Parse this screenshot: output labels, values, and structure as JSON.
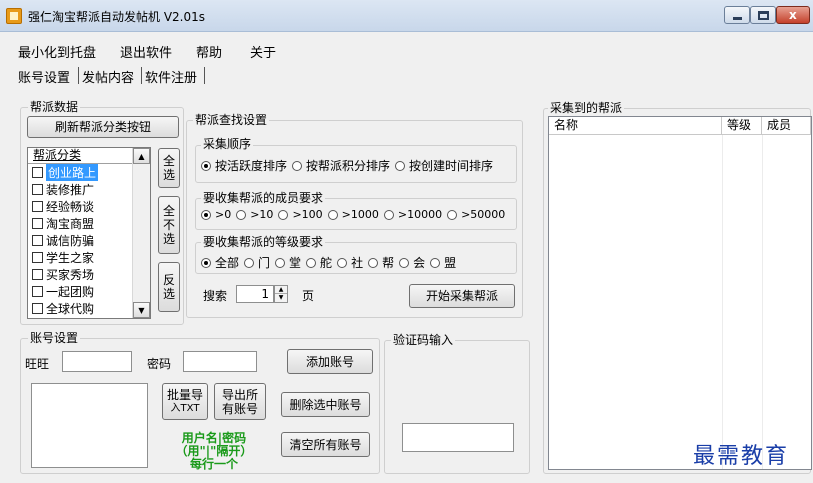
{
  "window": {
    "title": "强仁淘宝帮派自动发帖机 V2.01s",
    "close_glyph": "x"
  },
  "menu": [
    "最小化到托盘",
    "退出软件",
    "帮助",
    "关于"
  ],
  "tabs": [
    "账号设置",
    "发帖内容",
    "软件注册"
  ],
  "gang_data": {
    "legend": "帮派数据",
    "refresh_button": "刷新帮派分类按钮",
    "list_header": "帮派分类",
    "categories": [
      "创业路上",
      "装修推广",
      "经验畅谈",
      "淘宝商盟",
      "诚信防骗",
      "学生之家",
      "买家秀场",
      "一起团购",
      "全球代购"
    ],
    "select_all": "全选",
    "select_none": "全不选",
    "invert": "反选",
    "scroll_up_glyph": "▲",
    "scroll_down_glyph": "▼"
  },
  "search_settings": {
    "legend": "帮派查找设置",
    "order": {
      "legend": "采集顺序",
      "options": [
        "按活跃度排序",
        "按帮派积分排序",
        "按创建时间排序"
      ],
      "selected": 0
    },
    "members": {
      "legend": "要收集帮派的成员要求",
      "options": [
        ">0",
        ">10",
        ">100",
        ">1000",
        ">10000",
        ">50000"
      ],
      "selected": 0
    },
    "level": {
      "legend": "要收集帮派的等级要求",
      "options": [
        "全部",
        "门",
        "堂",
        "舵",
        "社",
        "帮",
        "会",
        "盟"
      ],
      "selected": 0
    },
    "search_label": "搜索",
    "page_value": "1",
    "page_unit": "页",
    "start_button": "开始采集帮派"
  },
  "collected": {
    "legend": "采集到的帮派",
    "columns": [
      "名称",
      "等级",
      "成员"
    ]
  },
  "account": {
    "legend": "账号设置",
    "wangwang_label": "旺旺",
    "wangwang_value": "",
    "password_label": "密码",
    "password_value": "",
    "add_button": "添加账号",
    "import_button_line1": "批量导",
    "import_button_line2": "入TXT",
    "export_button_line1": "导出所",
    "export_button_line2": "有账号",
    "delete_selected_button": "删除选中账号",
    "clear_all_button": "清空所有账号",
    "note_line1": "用户名|密码",
    "note_line2": "（用\"|\"隔开）",
    "note_line3": "每行一个"
  },
  "captcha": {
    "legend": "验证码输入",
    "value": ""
  },
  "watermark": "最需教育"
}
